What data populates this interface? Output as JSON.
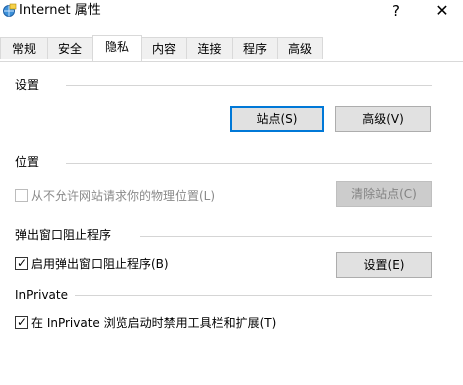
{
  "window": {
    "title": "Internet 属性",
    "help_glyph": "?",
    "close_glyph": "✕"
  },
  "tabs": [
    {
      "label": "常规"
    },
    {
      "label": "安全"
    },
    {
      "label": "隐私",
      "active": true
    },
    {
      "label": "内容"
    },
    {
      "label": "连接"
    },
    {
      "label": "程序"
    },
    {
      "label": "高级"
    }
  ],
  "settings": {
    "heading": "设置",
    "sites_button": "站点(S)",
    "advanced_button": "高级(V)"
  },
  "location": {
    "heading": "位置",
    "deny_checkbox_label": "从不允许网站请求你的物理位置(L)",
    "deny_checked": false,
    "clear_sites_button": "清除站点(C)"
  },
  "popup_blocker": {
    "heading": "弹出窗口阻止程序",
    "enable_checkbox_label": "启用弹出窗口阻止程序(B)",
    "enable_checked": true,
    "settings_button": "设置(E)"
  },
  "inprivate": {
    "heading": "InPrivate",
    "disable_toolbars_label": "在 InPrivate 浏览启动时禁用工具栏和扩展(T)",
    "disable_toolbars_checked": true
  }
}
